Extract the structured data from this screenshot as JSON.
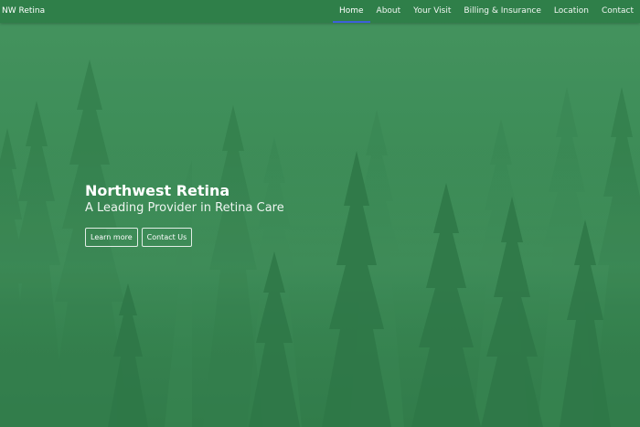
{
  "nav": {
    "brand": "NW Retina",
    "links": [
      {
        "label": "Home",
        "active": true
      },
      {
        "label": "About"
      },
      {
        "label": "Your Visit"
      },
      {
        "label": "Billing & Insurance"
      },
      {
        "label": "Location"
      },
      {
        "label": "Contact"
      }
    ]
  },
  "hero": {
    "title": "Northwest Retina",
    "subtitle": "A Leading Provider in Retina Care",
    "buttons": {
      "learn_more": "Learn more",
      "contact_us": "Contact Us"
    },
    "background": "misty-pine-forest"
  },
  "colors": {
    "nav_background": "#2f7f49",
    "hero_tint": "#3f8a57",
    "active_indicator": "#3d5fd9",
    "text": "#ffffff"
  }
}
